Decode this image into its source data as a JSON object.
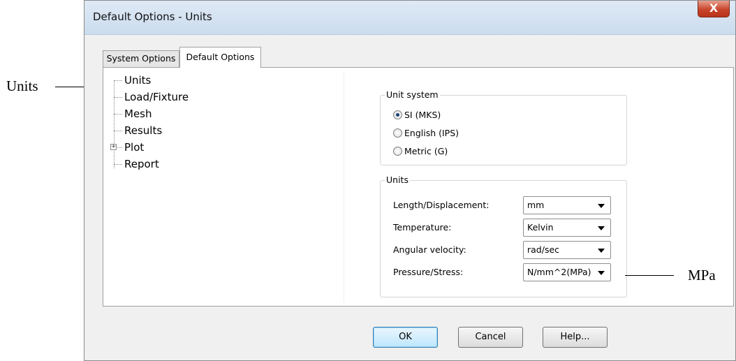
{
  "annotations": {
    "units_callout": "Units",
    "mpa_callout": "MPa"
  },
  "window": {
    "title": "Default Options - Units",
    "close_glyph": "X"
  },
  "tabs": [
    {
      "label": "System Options",
      "active": false
    },
    {
      "label": "Default Options",
      "active": true
    }
  ],
  "tree": {
    "items": [
      {
        "label": "Units",
        "selected": true
      },
      {
        "label": "Load/Fixture"
      },
      {
        "label": "Mesh"
      },
      {
        "label": "Results"
      },
      {
        "label": "Plot",
        "expander": "+"
      },
      {
        "label": "Report"
      }
    ]
  },
  "unit_system": {
    "legend": "Unit system",
    "options": [
      "SI (MKS)",
      "English (IPS)",
      "Metric (G)"
    ],
    "selected": "SI (MKS)"
  },
  "units": {
    "legend": "Units",
    "rows": [
      {
        "label": "Length/Displacement:",
        "value": "mm"
      },
      {
        "label": "Temperature:",
        "value": "Kelvin"
      },
      {
        "label": "Angular velocity:",
        "value": "rad/sec"
      },
      {
        "label": "Pressure/Stress:",
        "value": "N/mm^2(MPa)"
      }
    ]
  },
  "buttons": {
    "ok": "OK",
    "cancel": "Cancel",
    "help": "Help..."
  }
}
